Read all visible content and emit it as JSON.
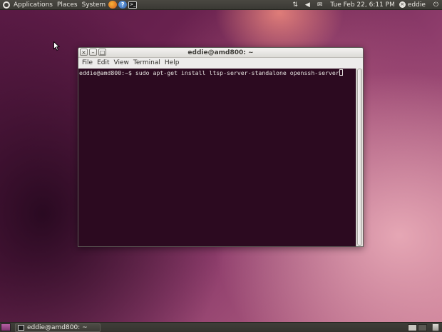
{
  "top_panel": {
    "menus": [
      "Applications",
      "Places",
      "System"
    ],
    "launchers": [
      {
        "name": "firefox-icon",
        "glyph": ""
      },
      {
        "name": "help-icon",
        "glyph": "?"
      },
      {
        "name": "terminal-icon",
        "glyph": ">_"
      }
    ],
    "tray": {
      "network_glyph": "⇅",
      "volume_glyph": "◀",
      "mail_glyph": "✉"
    },
    "clock": "Tue Feb 22,  6:11 PM",
    "user": "eddie",
    "power_glyph": "⏻"
  },
  "terminal_window": {
    "title": "eddie@amd800: ~",
    "controls": {
      "close": "×",
      "minimize": "–",
      "maximize": "□"
    },
    "menu": [
      "File",
      "Edit",
      "View",
      "Terminal",
      "Help"
    ],
    "prompt": "eddie@amd800:~$ ",
    "command": "sudo apt-get install ltsp-server-standalone openssh-server",
    "background_color": "#2c0a20",
    "text_color": "#e4e1de"
  },
  "bottom_panel": {
    "task": "eddie@amd800: ~",
    "workspaces": [
      {
        "active": true
      },
      {
        "active": false
      }
    ]
  }
}
